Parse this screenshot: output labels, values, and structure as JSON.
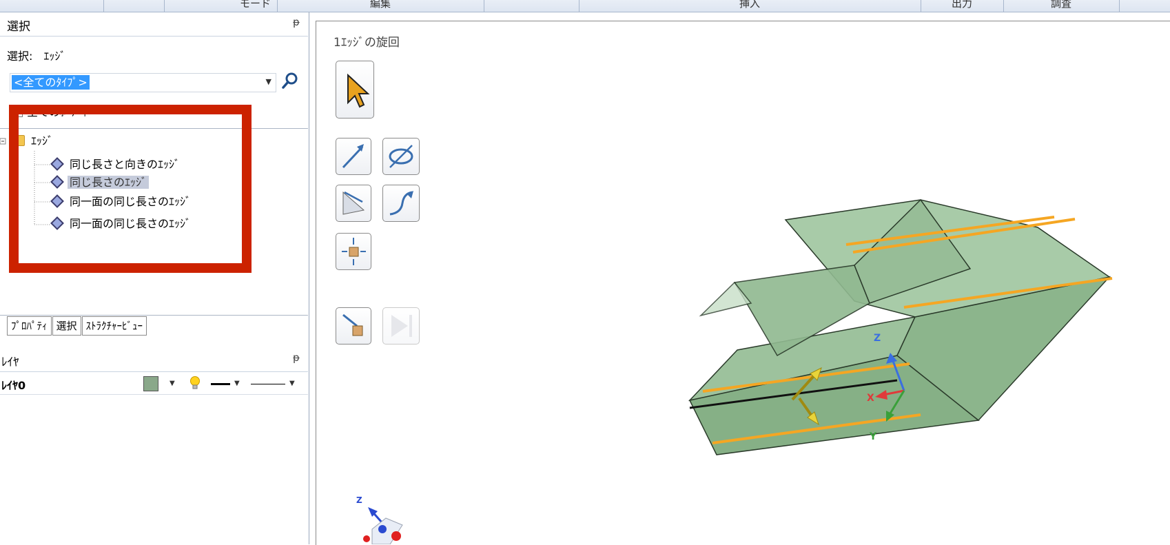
{
  "ribbon": {
    "groups": [
      "モード",
      "編集",
      "挿入",
      "出力",
      "調査"
    ]
  },
  "selection_panel": {
    "title": "選択",
    "pin": "ᵽ",
    "select_label": "選択:　ｴｯｼﾞ",
    "type_filter_value": "<全てのﾀｲﾌﾟ>",
    "all_bodies_label": "全てのﾎﾞﾃﾞｨ",
    "tree": {
      "root": "ｴｯｼﾞ",
      "items": [
        {
          "label": "同じ長さと向きのｴｯｼﾞ",
          "selected": false
        },
        {
          "label": "同じ長さのｴｯｼﾞ",
          "selected": true
        },
        {
          "label": "同一面の同じ長さのｴｯｼﾞ",
          "selected": false
        },
        {
          "label": "同一面の同じ長さのｴｯｼﾞ",
          "selected": false
        }
      ]
    }
  },
  "tabs": [
    "ﾌﾟﾛﾊﾟﾃｨ",
    "選択",
    "ｽﾄﾗｸﾁｬｰﾋﾞｭｰ"
  ],
  "layer_panel": {
    "title": "ﾚｲﾔ",
    "pin": "ᵽ",
    "layer_name": "ﾚｲﾔ0",
    "layer_color": "#8aa88a"
  },
  "viewport": {
    "tool_title": "1ｴｯｼﾞの旋回",
    "axis_labels": {
      "x": "X",
      "y": "Y",
      "z": "Z"
    },
    "icons": [
      "select-arrow-icon",
      "direction-arrow-icon",
      "rotate-axis-icon",
      "angle-icon",
      "path-curve-icon",
      "anchor-center-icon",
      "move-body-icon",
      "complete-icon"
    ]
  },
  "colors": {
    "highlight_box": "#cc2200",
    "selection_blue": "#3399ff",
    "body_green": "#8fba8f",
    "edge_orange": "#f5a623"
  }
}
